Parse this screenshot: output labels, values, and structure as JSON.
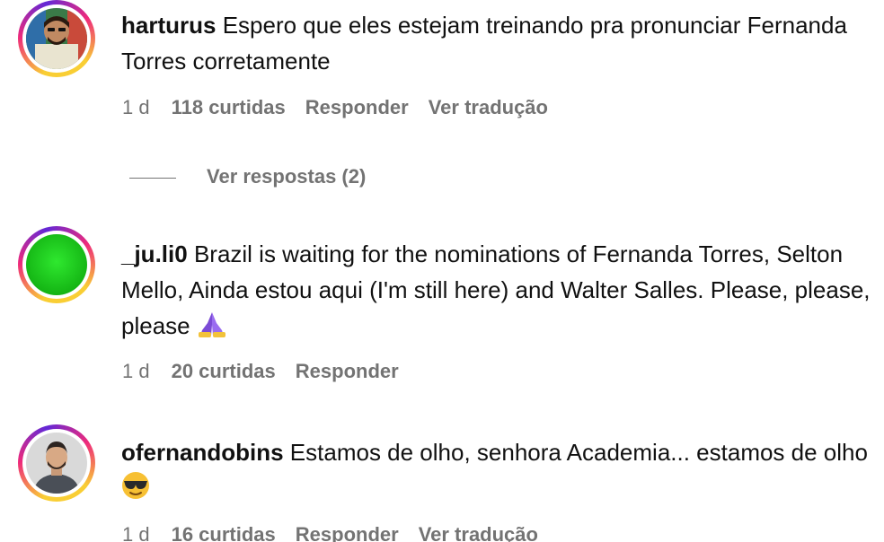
{
  "comments": [
    {
      "username": "harturus",
      "text": "Espero que eles estejam treinando pra pronunciar Fernanda Torres corretamente",
      "time": "1 d",
      "likes": "118 curtidas",
      "reply": "Responder",
      "translate": "Ver tradução",
      "replies_label": "Ver respostas (2)",
      "avatar": "user-photo"
    },
    {
      "username": "_ju.li0",
      "text": "Brazil is waiting for the nominations of Fernanda Torres, Selton Mello, Ainda estou aqui (I'm still here) and Walter Salles. Please, please, please",
      "emoji": "folded-hands-emoji",
      "time": "1 d",
      "likes": "20 curtidas",
      "reply": "Responder",
      "avatar": "green-circle"
    },
    {
      "username": "ofernandobins",
      "text": "Estamos de olho, senhora Academia... estamos de olho",
      "emoji": "sunglasses-emoji",
      "time": "1 d",
      "likes": "16 curtidas",
      "reply": "Responder",
      "translate": "Ver tradução",
      "avatar": "user-photo"
    }
  ],
  "colors": {
    "text": "#111111",
    "secondary": "#737373",
    "ring_yellow": "#f9ce34",
    "ring_pink": "#ee2a7b",
    "avatar_green": "#1fd11f"
  }
}
